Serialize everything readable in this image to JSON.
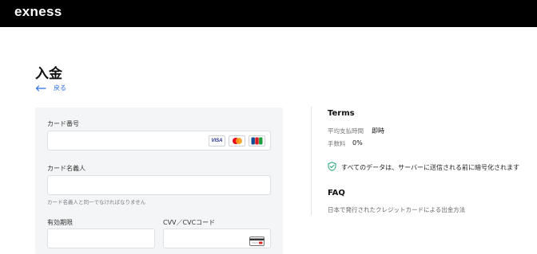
{
  "header": {
    "logo": "exness"
  },
  "page": {
    "title": "入金",
    "back_label": "戻る"
  },
  "form": {
    "card_number": {
      "label": "カード番号",
      "value": "",
      "placeholder": ""
    },
    "card_brands": [
      "VISA",
      "mastercard",
      "JCB"
    ],
    "cardholder": {
      "label": "カード名義人",
      "value": "",
      "placeholder": "",
      "hint": "カード名義人と同一でなければなりません"
    },
    "expiry": {
      "label": "有効期限",
      "value": "",
      "placeholder": ""
    },
    "cvv": {
      "label": "CVV／CVCコード",
      "value": "",
      "placeholder": ""
    }
  },
  "terms": {
    "title": "Terms",
    "processing_time_label": "平均支払時間",
    "processing_time_value": "即時",
    "fee_label": "手数料",
    "fee_value": "0%",
    "security_note": "すべてのデータは、サーバーに送信される前に暗号化されます"
  },
  "faq": {
    "title": "FAQ",
    "items": [
      "日本で発行されたクレジットカードによる出金方法"
    ]
  },
  "colors": {
    "topbar": "#000000",
    "accent": "#2e6fe0",
    "card_bg": "#f4f5f6",
    "shield": "#2aa876"
  }
}
